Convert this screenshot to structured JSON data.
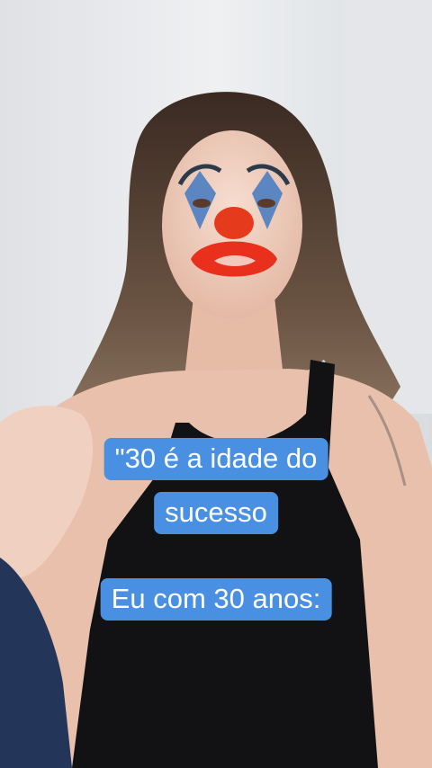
{
  "captions": {
    "line1": "\"30 é a idade do",
    "line2": "sucesso",
    "line3": "Eu com 30 anos:"
  },
  "colors": {
    "caption_bg": "#4a90e2",
    "caption_text": "#ffffff",
    "wall": "#e9eaec"
  }
}
